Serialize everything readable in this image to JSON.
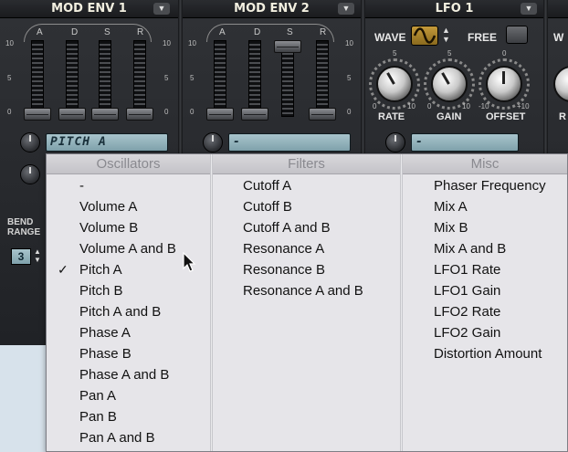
{
  "synth": {
    "sections": {
      "mod_env_1": "MOD ENV 1",
      "mod_env_2": "MOD ENV 2",
      "lfo_1": "LFO 1"
    },
    "adsr": [
      "A",
      "D",
      "S",
      "R"
    ],
    "scale": {
      "top": "10",
      "mid": "5",
      "bottom": "0"
    },
    "lfo": {
      "wave_label": "WAVE",
      "free_label": "FREE",
      "partial_label": "W",
      "knobs": [
        "RATE",
        "GAIN",
        "OFFSET"
      ],
      "partial_knob_label": "R",
      "rate_scale": {
        "top": "5",
        "left": "0",
        "right": "10"
      },
      "gain_scale": {
        "top": "5",
        "left": "0",
        "right": "10"
      },
      "offset_scale": {
        "top": "0",
        "left": "-10",
        "right": "+10"
      }
    },
    "mod_env_1_target": "PITCH A",
    "mod_env_2_target": "-",
    "lfo_1_target": "-",
    "bend_range": {
      "label_line1": "BEND",
      "label_line2": "RANGE",
      "value": "3"
    },
    "colors": {
      "panel": "#2a2c30",
      "lcd": "#9ab8c1",
      "accent": "#c49a3a"
    }
  },
  "menu": {
    "columns": [
      {
        "header": "Oscillators",
        "items": [
          "-",
          "Volume A",
          "Volume B",
          "Volume A and B",
          "Pitch A",
          "Pitch B",
          "Pitch A and B",
          "Phase A",
          "Phase B",
          "Phase A and B",
          "Pan A",
          "Pan B",
          "Pan A and B"
        ],
        "checked": "Pitch A",
        "check_mark": "✓"
      },
      {
        "header": "Filters",
        "items": [
          "Cutoff A",
          "Cutoff B",
          "Cutoff A and B",
          "Resonance A",
          "Resonance B",
          "Resonance A and B"
        ]
      },
      {
        "header": "Misc",
        "items": [
          "Phaser Frequency",
          "Mix A",
          "Mix B",
          "Mix A and B",
          "LFO1 Rate",
          "LFO1 Gain",
          "LFO2 Rate",
          "LFO2 Gain",
          "Distortion Amount"
        ]
      }
    ]
  }
}
